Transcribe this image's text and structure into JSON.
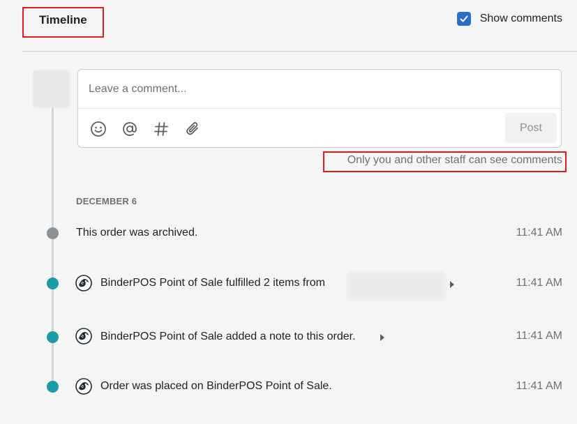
{
  "header": {
    "title": "Timeline",
    "show_comments_label": "Show comments",
    "show_comments_checked": true
  },
  "composer": {
    "placeholder": "Leave a comment...",
    "tools": [
      "emoji-icon",
      "mention-icon",
      "hashtag-icon",
      "attachment-icon"
    ],
    "post_label": "Post"
  },
  "staff_note": "Only you and other staff can see comments",
  "timeline": {
    "date_heading": "DECEMBER 6",
    "events": [
      {
        "text": "This order was archived.",
        "time": "11:41 AM",
        "dot_color": "#8c9196",
        "has_app_icon": false,
        "expandable": false
      },
      {
        "text": "BinderPOS Point of Sale fulfilled 2 items from",
        "time": "11:41 AM",
        "dot_color": "#1b9aaa",
        "has_app_icon": true,
        "expandable": true
      },
      {
        "text": "BinderPOS Point of Sale added a note to this order.",
        "time": "11:41 AM",
        "dot_color": "#1b9aaa",
        "has_app_icon": true,
        "expandable": true
      },
      {
        "text": "Order was placed on BinderPOS Point of Sale.",
        "time": "11:41 AM",
        "dot_color": "#1b9aaa",
        "has_app_icon": true,
        "expandable": false
      }
    ]
  },
  "colors": {
    "accent": "#2c6ecb",
    "timeline_dot_active": "#1b9aaa",
    "timeline_dot_inactive": "#8c9196",
    "highlight_border": "#e01b24"
  }
}
